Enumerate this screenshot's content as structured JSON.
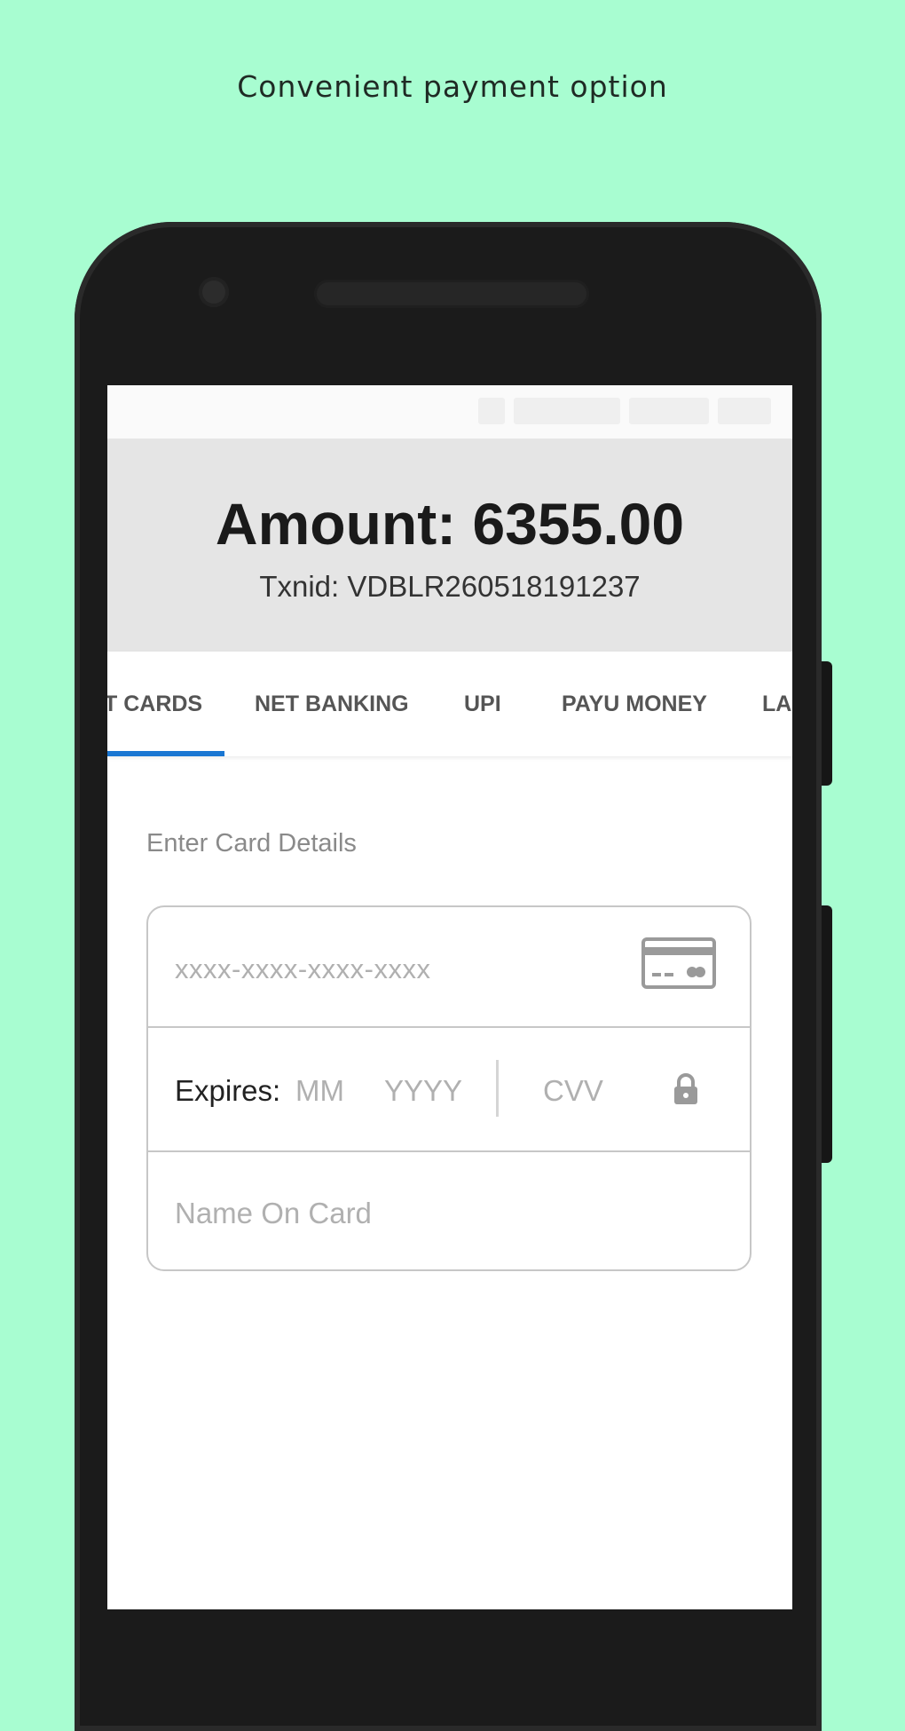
{
  "caption": "Convenient payment option",
  "header": {
    "amount": "Amount: 6355.00",
    "txnid": "Txnid: VDBLR260518191237"
  },
  "tabs": [
    {
      "label": "T CARDS",
      "active": true
    },
    {
      "label": "NET BANKING",
      "active": false
    },
    {
      "label": "UPI",
      "active": false
    },
    {
      "label": "PAYU MONEY",
      "active": false
    },
    {
      "label": "LA",
      "active": false
    }
  ],
  "form": {
    "section_label": "Enter Card Details",
    "card_number_placeholder": "xxxx-xxxx-xxxx-xxxx",
    "expires_label": "Expires:",
    "month_placeholder": "MM",
    "year_placeholder": "YYYY",
    "cvv_placeholder": "CVV",
    "name_placeholder": "Name On Card"
  },
  "icons": {
    "card": "credit-card-icon",
    "lock": "lock-icon"
  },
  "colors": {
    "background": "#a8fdd1",
    "tab_indicator": "#1976d2",
    "header_bg": "#e5e5e5"
  }
}
